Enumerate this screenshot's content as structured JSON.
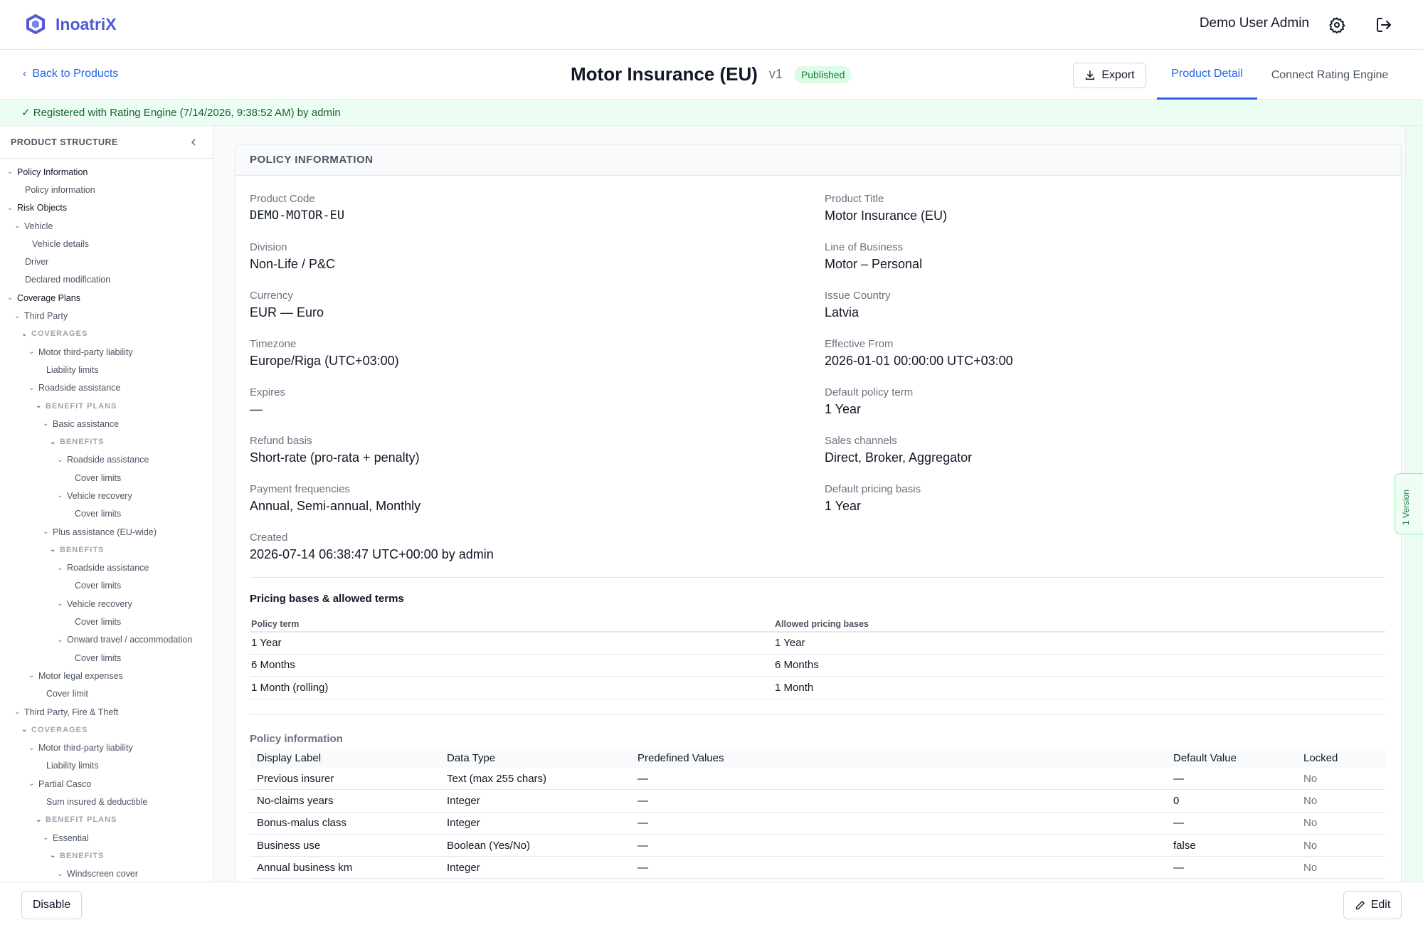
{
  "app": {
    "name": "InoatriX",
    "user": "Demo User Admin"
  },
  "nav": {
    "back_label": "Back to Products",
    "export_label": "Export",
    "tabs": [
      "Product Detail",
      "Connect Rating Engine"
    ]
  },
  "product": {
    "title": "Motor Insurance (EU)",
    "version": "v1",
    "status": "Published"
  },
  "banner": "✓ Registered with Rating Engine (7/14/2026, 9:38:52 AM) by admin",
  "sidebar": {
    "title": "PRODUCT STRUCTURE",
    "nodes": [
      {
        "label": "Policy Information",
        "level": 0,
        "exp": true
      },
      {
        "label": "Policy information",
        "level": 1,
        "exp": false
      },
      {
        "label": "Risk Objects",
        "level": 0,
        "exp": true
      },
      {
        "label": "Vehicle",
        "level": 1,
        "exp": true
      },
      {
        "label": "Vehicle details",
        "level": 2,
        "exp": false
      },
      {
        "label": "Driver",
        "level": 1,
        "exp": false
      },
      {
        "label": "Declared modification",
        "level": 1,
        "exp": false
      },
      {
        "label": "Coverage Plans",
        "level": 0,
        "exp": true
      },
      {
        "label": "Third Party",
        "level": 1,
        "exp": true
      },
      {
        "label": "COVERAGES",
        "level": 2,
        "exp": true,
        "sec": true
      },
      {
        "label": "Motor third-party liability",
        "level": 3,
        "exp": true
      },
      {
        "label": "Liability limits",
        "level": 4,
        "exp": false
      },
      {
        "label": "Roadside assistance",
        "level": 3,
        "exp": true
      },
      {
        "label": "BENEFIT PLANS",
        "level": 4,
        "exp": true,
        "sec": true
      },
      {
        "label": "Basic assistance",
        "level": 5,
        "exp": true
      },
      {
        "label": "BENEFITS",
        "level": 6,
        "exp": true,
        "sec": true
      },
      {
        "label": "Roadside assistance",
        "level": 7,
        "exp": true
      },
      {
        "label": "Cover limits",
        "level": 8,
        "exp": false
      },
      {
        "label": "Vehicle recovery",
        "level": 7,
        "exp": true
      },
      {
        "label": "Cover limits",
        "level": 8,
        "exp": false
      },
      {
        "label": "Plus assistance (EU-wide)",
        "level": 5,
        "exp": true
      },
      {
        "label": "BENEFITS",
        "level": 6,
        "exp": true,
        "sec": true
      },
      {
        "label": "Roadside assistance",
        "level": 7,
        "exp": true
      },
      {
        "label": "Cover limits",
        "level": 8,
        "exp": false
      },
      {
        "label": "Vehicle recovery",
        "level": 7,
        "exp": true
      },
      {
        "label": "Cover limits",
        "level": 8,
        "exp": false
      },
      {
        "label": "Onward travel / accommodation",
        "level": 7,
        "exp": true
      },
      {
        "label": "Cover limits",
        "level": 8,
        "exp": false
      },
      {
        "label": "Motor legal expenses",
        "level": 3,
        "exp": true
      },
      {
        "label": "Cover limit",
        "level": 4,
        "exp": false
      },
      {
        "label": "Third Party, Fire & Theft",
        "level": 1,
        "exp": true
      },
      {
        "label": "COVERAGES",
        "level": 2,
        "exp": true,
        "sec": true
      },
      {
        "label": "Motor third-party liability",
        "level": 3,
        "exp": true
      },
      {
        "label": "Liability limits",
        "level": 4,
        "exp": false
      },
      {
        "label": "Partial Casco",
        "level": 3,
        "exp": true
      },
      {
        "label": "Sum insured & deductible",
        "level": 4,
        "exp": false
      },
      {
        "label": "BENEFIT PLANS",
        "level": 4,
        "exp": true,
        "sec": true
      },
      {
        "label": "Essential",
        "level": 5,
        "exp": true
      },
      {
        "label": "BENEFITS",
        "level": 6,
        "exp": true,
        "sec": true
      },
      {
        "label": "Windscreen cover",
        "level": 7,
        "exp": true
      }
    ]
  },
  "policy_info": {
    "section_title": "POLICY INFORMATION",
    "fields": [
      {
        "label": "Product Code",
        "value": "DEMO-MOTOR-EU",
        "mono": true
      },
      {
        "label": "Product Title",
        "value": "Motor Insurance (EU)"
      },
      {
        "label": "Division",
        "value": "Non-Life / P&C"
      },
      {
        "label": "Line of Business",
        "value": "Motor – Personal"
      },
      {
        "label": "Currency",
        "value": "EUR — Euro"
      },
      {
        "label": "Issue Country",
        "value": "Latvia"
      },
      {
        "label": "Timezone",
        "value": "Europe/Riga (UTC+03:00)"
      },
      {
        "label": "Effective From",
        "value": "2026-01-01 00:00:00 UTC+03:00"
      },
      {
        "label": "Expires",
        "value": "—"
      },
      {
        "label": "Default policy term",
        "value": "1 Year"
      },
      {
        "label": "Refund basis",
        "value": "Short-rate (pro-rata + penalty)"
      },
      {
        "label": "Sales channels",
        "value": "Direct, Broker, Aggregator"
      },
      {
        "label": "Payment frequencies",
        "value": "Annual, Semi-annual, Monthly"
      },
      {
        "label": "Default pricing basis",
        "value": "1 Year"
      },
      {
        "label": "Created",
        "value": "2026-07-14 06:38:47 UTC+00:00 by admin"
      }
    ]
  },
  "pricing": {
    "title": "Pricing bases & allowed terms",
    "headers": [
      "Policy term",
      "Allowed pricing bases"
    ],
    "rows": [
      [
        "1 Year",
        "1 Year"
      ],
      [
        "6 Months",
        "6 Months"
      ],
      [
        "1 Month (rolling)",
        "1 Month"
      ]
    ]
  },
  "attributes": {
    "title": "Policy information",
    "headers": [
      "Display Label",
      "Data Type",
      "Predefined Values",
      "Default Value",
      "Locked"
    ],
    "rows": [
      [
        "Previous insurer",
        "Text (max 255 chars)",
        "—",
        "—",
        "No"
      ],
      [
        "No-claims years",
        "Integer",
        "—",
        "0",
        "No"
      ],
      [
        "Bonus-malus class",
        "Integer",
        "—",
        "—",
        "No"
      ],
      [
        "Business use",
        "Boolean (Yes/No)",
        "—",
        "false",
        "No"
      ],
      [
        "Annual business km",
        "Integer",
        "—",
        "—",
        "No"
      ]
    ]
  },
  "version_tab": "1 Version",
  "footer": {
    "disable_label": "Disable",
    "edit_label": "Edit"
  }
}
